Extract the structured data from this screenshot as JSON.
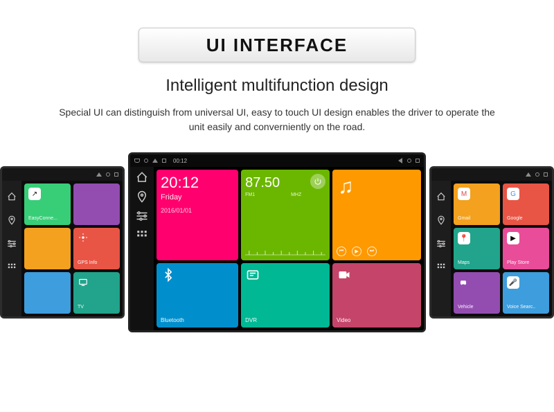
{
  "header": {
    "badge": "UI INTERFACE",
    "subtitle": "Intelligent multifunction design",
    "description": "Special UI can distinguish from universal UI, easy to touch UI design enables the driver to operate the unit easily and converniently on the road."
  },
  "status": {
    "clock": "00:12"
  },
  "nav_icons": {
    "home": "home-icon",
    "pin": "pin-icon",
    "sliders": "sliders-icon",
    "grid": "grid-icon"
  },
  "center": {
    "clock": {
      "time": "20:12",
      "day": "Friday",
      "date": "2016/01/01"
    },
    "radio": {
      "freq": "87.50",
      "band": "FM1",
      "unit": "MHZ"
    },
    "tiles": {
      "bluetooth": "Bluetooth",
      "dvr": "DVR",
      "video": "Video"
    }
  },
  "left": {
    "tiles": [
      {
        "label": "EasyConne...",
        "color": "c-green"
      },
      {
        "label": "",
        "color": "c-purple"
      },
      {
        "label": "",
        "color": "c-orange"
      },
      {
        "label": "GPS Info",
        "color": "c-red"
      },
      {
        "label": "",
        "color": "c-blue"
      },
      {
        "label": "TV",
        "color": "c-teal"
      }
    ]
  },
  "right": {
    "tiles": [
      {
        "label": "Gmail",
        "color": "c-orange"
      },
      {
        "label": "Google",
        "color": "c-red"
      },
      {
        "label": "",
        "color": "c-dblue"
      },
      {
        "label": "Maps",
        "color": "c-teal"
      },
      {
        "label": "Play Store",
        "color": "c-pink"
      },
      {
        "label": "Vehicle",
        "color": "c-purple"
      },
      {
        "label": "Voice Searc..",
        "color": "c-blue"
      }
    ]
  }
}
